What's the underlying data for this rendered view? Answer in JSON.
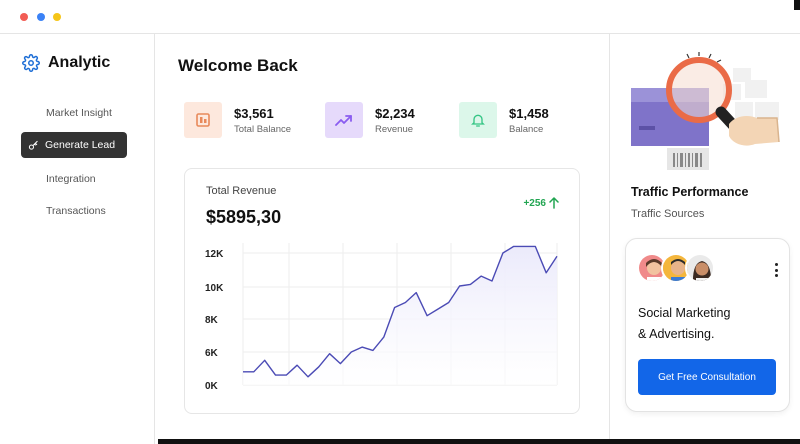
{
  "window": {
    "controls": [
      "close",
      "minimize",
      "maximize"
    ]
  },
  "sidebar": {
    "brand": "Analytic",
    "brand_icon": "gear-icon",
    "items": [
      {
        "label": "Market Insight",
        "active": false
      },
      {
        "label": "Generate Lead",
        "active": true,
        "icon": "key-icon"
      },
      {
        "label": "Integration",
        "active": false
      },
      {
        "label": "Transactions",
        "active": false
      }
    ]
  },
  "main": {
    "title": "Welcome Back",
    "stats": [
      {
        "value": "$3,561",
        "label": "Total Balance",
        "icon": "wallet-icon",
        "bg": "#fde8dd",
        "fg": "#e8895a"
      },
      {
        "value": "$2,234",
        "label": "Revenue",
        "icon": "trending-up-icon",
        "bg": "#e6dafb",
        "fg": "#8a5cf0"
      },
      {
        "value": "$1,458",
        "label": "Balance",
        "icon": "bell-icon",
        "bg": "#dcf7ea",
        "fg": "#34c585"
      }
    ],
    "revenue": {
      "title": "Total Revenue",
      "total": "$5895,30",
      "delta": "+256"
    }
  },
  "chart_data": {
    "type": "area",
    "title": "Total Revenue",
    "y_ticks": [
      "12K",
      "10K",
      "8K",
      "6K",
      "0K"
    ],
    "y_tick_values": [
      12,
      10,
      8,
      6,
      4
    ],
    "ylim": [
      4,
      12
    ],
    "grid": true,
    "line_color": "#4b4bb5",
    "fill_color": "#ebeafb",
    "series": [
      {
        "values": [
          4.8,
          4.8,
          5.5,
          4.6,
          4.6,
          5.2,
          4.5,
          5.1,
          5.9,
          5.3,
          6.0,
          6.3,
          6.1,
          6.9,
          8.7,
          9.0,
          9.6,
          8.2,
          8.6,
          9.0,
          10.0,
          10.1,
          10.6,
          10.3,
          12.0,
          12.4,
          12.4,
          12.4,
          10.8,
          11.8
        ]
      }
    ]
  },
  "right": {
    "title": "Traffic Performance",
    "subtitle": "Traffic Sources",
    "card": {
      "text_line1": "Social Marketing",
      "text_line2": "& Advertising.",
      "button": "Get Free Consultation",
      "menu_icon": "more-vertical-icon"
    }
  },
  "colors": {
    "accent": "#1266e8",
    "active_nav": "#333333",
    "positive": "#22a552"
  }
}
